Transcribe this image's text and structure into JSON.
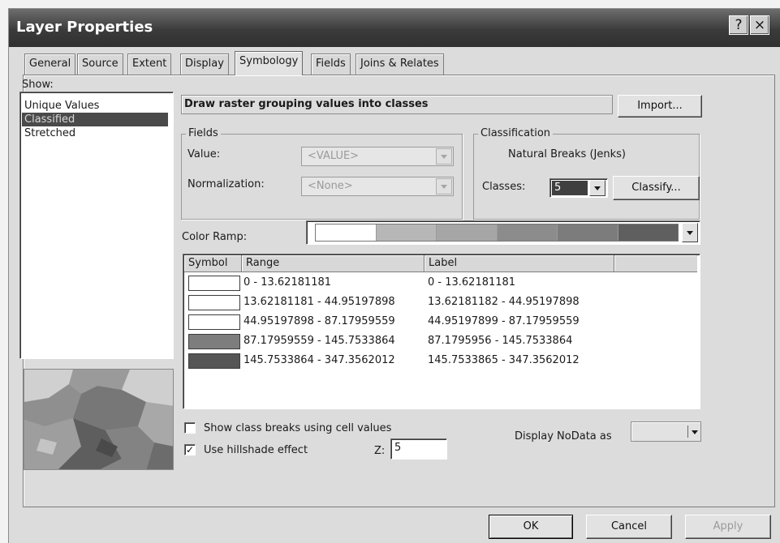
{
  "window": {
    "title": "Layer Properties",
    "help_glyph": "?",
    "close_glyph": "×"
  },
  "tabs": [
    {
      "label": "General",
      "active": false
    },
    {
      "label": "Source",
      "active": false
    },
    {
      "label": "Extent",
      "active": false
    },
    {
      "label": "Display",
      "active": false
    },
    {
      "label": "Symbology",
      "active": true
    },
    {
      "label": "Fields",
      "active": false
    },
    {
      "label": "Joins & Relates",
      "active": false
    }
  ],
  "show": {
    "label": "Show:",
    "items": [
      "Unique Values",
      "Classified",
      "Stretched"
    ],
    "selected": "Classified"
  },
  "description": "Draw raster grouping values into classes",
  "import_button": "Import...",
  "fields": {
    "group_title": "Fields",
    "value_label": "Value:",
    "value_selected": "<VALUE>",
    "normalization_label": "Normalization:",
    "normalization_selected": "<None>"
  },
  "classification": {
    "group_title": "Classification",
    "method": "Natural Breaks (Jenks)",
    "classes_label": "Classes:",
    "classes_value": "5",
    "classify_button": "Classify..."
  },
  "color_ramp": {
    "label": "Color Ramp:",
    "colors": [
      "#ffffff",
      "#b7b7b7",
      "#a6a6a6",
      "#8c8c8c",
      "#7c7c7c",
      "#5f5f5f"
    ]
  },
  "symbol_table": {
    "headers": [
      "Symbol",
      "Range",
      "Label"
    ],
    "rows": [
      {
        "color": "#ffffff",
        "range": "0 - 13.62181181",
        "label": "0 - 13.62181181"
      },
      {
        "color": "#ffffff",
        "range": "13.62181181 - 44.95197898",
        "label": "13.62181182 - 44.95197898"
      },
      {
        "color": "#ffffff",
        "range": "44.95197898 - 87.17959559",
        "label": "44.95197899 - 87.17959559"
      },
      {
        "color": "#7d7d7d",
        "range": "87.17959559 - 145.7533864",
        "label": "87.1795956 - 145.7533864"
      },
      {
        "color": "#555555",
        "range": "145.7533864 - 347.3562012",
        "label": "145.7533865 - 347.3562012"
      }
    ]
  },
  "options": {
    "show_breaks_label": "Show class breaks using cell values",
    "show_breaks_checked": false,
    "hillshade_label": "Use hillshade effect",
    "hillshade_checked": true,
    "z_label": "Z:",
    "z_value": "5",
    "nodata_label": "Display NoData as"
  },
  "footer": {
    "ok": "OK",
    "cancel": "Cancel",
    "apply": "Apply"
  }
}
